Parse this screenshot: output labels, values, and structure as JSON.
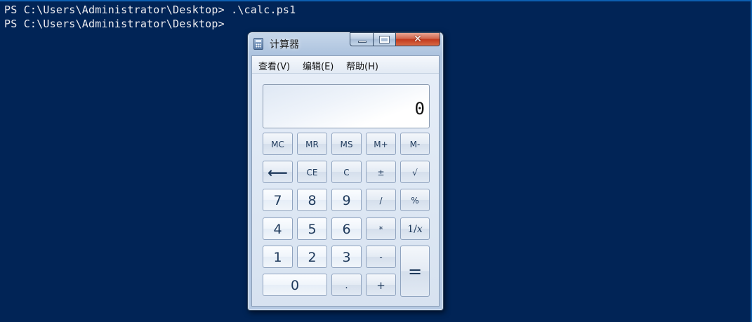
{
  "console": {
    "line1": "PS C:\\Users\\Administrator\\Desktop> .\\calc.ps1",
    "line2": "PS C:\\Users\\Administrator\\Desktop>"
  },
  "calculator": {
    "title": "计算器",
    "menu": {
      "view": "查看(V)",
      "edit": "编辑(E)",
      "help": "帮助(H)"
    },
    "display": "0",
    "keys": {
      "mc": "MC",
      "mr": "MR",
      "ms": "MS",
      "mplus": "M+",
      "mminus": "M-",
      "backspace": "⟵",
      "ce": "CE",
      "c": "C",
      "sign": "±",
      "sqrt": "√",
      "k7": "7",
      "k8": "8",
      "k9": "9",
      "div": "/",
      "pct": "%",
      "k4": "4",
      "k5": "5",
      "k6": "6",
      "mul": "*",
      "recip": "1/𝑥",
      "k1": "1",
      "k2": "2",
      "k3": "3",
      "sub": "-",
      "eq": "=",
      "k0": "0",
      "dot": ".",
      "add": "+"
    }
  },
  "colors": {
    "console_bg": "#012456",
    "console_text": "#eeedf0",
    "close_button": "#c1391d"
  },
  "icons": {
    "app": "calculator-icon",
    "minimize": "minimize-icon",
    "maximize": "maximize-icon",
    "close": "close-icon"
  }
}
